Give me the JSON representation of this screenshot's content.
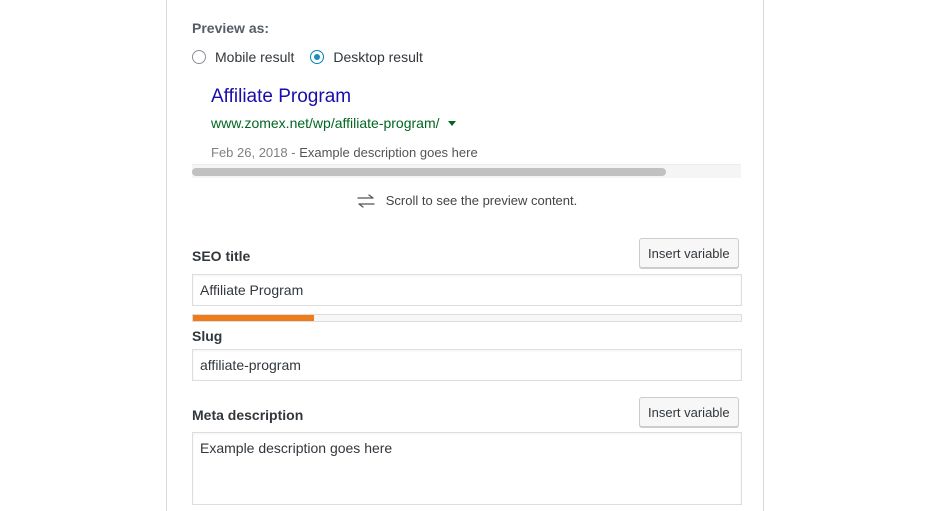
{
  "preview": {
    "label": "Preview as:",
    "options": [
      {
        "label": "Mobile result",
        "checked": false
      },
      {
        "label": "Desktop result",
        "checked": true
      }
    ]
  },
  "serp": {
    "title": "Affiliate Program",
    "url": "www.zomex.net/wp/affiliate-program/",
    "date": "Feb 26, 2018",
    "separator": " - ",
    "description": "Example description goes here"
  },
  "scroll_hint": {
    "text": "Scroll to see the preview content.",
    "icon": "swap-arrows-icon"
  },
  "seo_title": {
    "label": "SEO title",
    "insert_variable_label": "Insert variable",
    "value": "Affiliate Program",
    "progress_fraction": 0.22,
    "progress_color": "#ee7c1b"
  },
  "slug": {
    "label": "Slug",
    "value": "affiliate-program"
  },
  "meta_description": {
    "label": "Meta description",
    "insert_variable_label": "Insert variable",
    "value": "Example description goes here"
  },
  "colors": {
    "serp_title": "#1a0dab",
    "serp_url": "#006621",
    "radio_accent": "#1e8cbe"
  }
}
